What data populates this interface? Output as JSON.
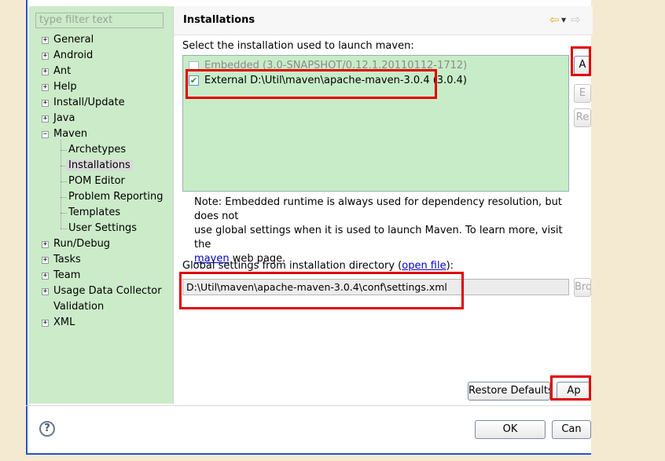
{
  "filter": {
    "placeholder": "type filter text"
  },
  "sidebar": {
    "items": [
      {
        "label": "General",
        "expander": "+"
      },
      {
        "label": "Android",
        "expander": "+"
      },
      {
        "label": "Ant",
        "expander": "+"
      },
      {
        "label": "Help",
        "expander": "+"
      },
      {
        "label": "Install/Update",
        "expander": "+"
      },
      {
        "label": "Java",
        "expander": "+"
      },
      {
        "label": "Maven",
        "expander": "−"
      },
      {
        "label": "Archetypes"
      },
      {
        "label": "Installations"
      },
      {
        "label": "POM Editor"
      },
      {
        "label": "Problem Reporting"
      },
      {
        "label": "Templates"
      },
      {
        "label": "User Settings"
      },
      {
        "label": "Run/Debug",
        "expander": "+"
      },
      {
        "label": "Tasks",
        "expander": "+"
      },
      {
        "label": "Team",
        "expander": "+"
      },
      {
        "label": "Usage Data Collector",
        "expander": "+"
      },
      {
        "label": "Validation"
      },
      {
        "label": "XML",
        "expander": "+"
      }
    ]
  },
  "header": {
    "title": "Installations"
  },
  "main": {
    "select_label": "Select the installation used to launch maven:",
    "installations": [
      {
        "label": "Embedded (3.0-SNAPSHOT/0.12.1.20110112-1712)",
        "checked": false
      },
      {
        "label": "External D:\\Util\\maven\\apache-maven-3.0.4 (3.0.4)",
        "checked": true
      }
    ],
    "side_buttons": {
      "add": "A",
      "edit": "E",
      "remove": "Re"
    },
    "note_line1": "Note: Embedded runtime is always used for dependency resolution, but does not",
    "note_line2": "use global settings when it is used to launch Maven. To learn more, visit the",
    "note_link": "maven",
    "note_tail": " web page.",
    "global_label": "Global settings from installation directory (",
    "global_link": "open file",
    "global_label_end": "):",
    "global_path": "D:\\Util\\maven\\apache-maven-3.0.4\\conf\\settings.xml",
    "browse_label": "Bro",
    "restore_label": "Restore Defaults",
    "apply_label": "Ap"
  },
  "footer": {
    "ok": "OK",
    "cancel": "Can"
  },
  "colors": {
    "sidebar_bg": "#ccebc9",
    "table_bg": "#c8ecc8",
    "highlight": "#e00000"
  }
}
